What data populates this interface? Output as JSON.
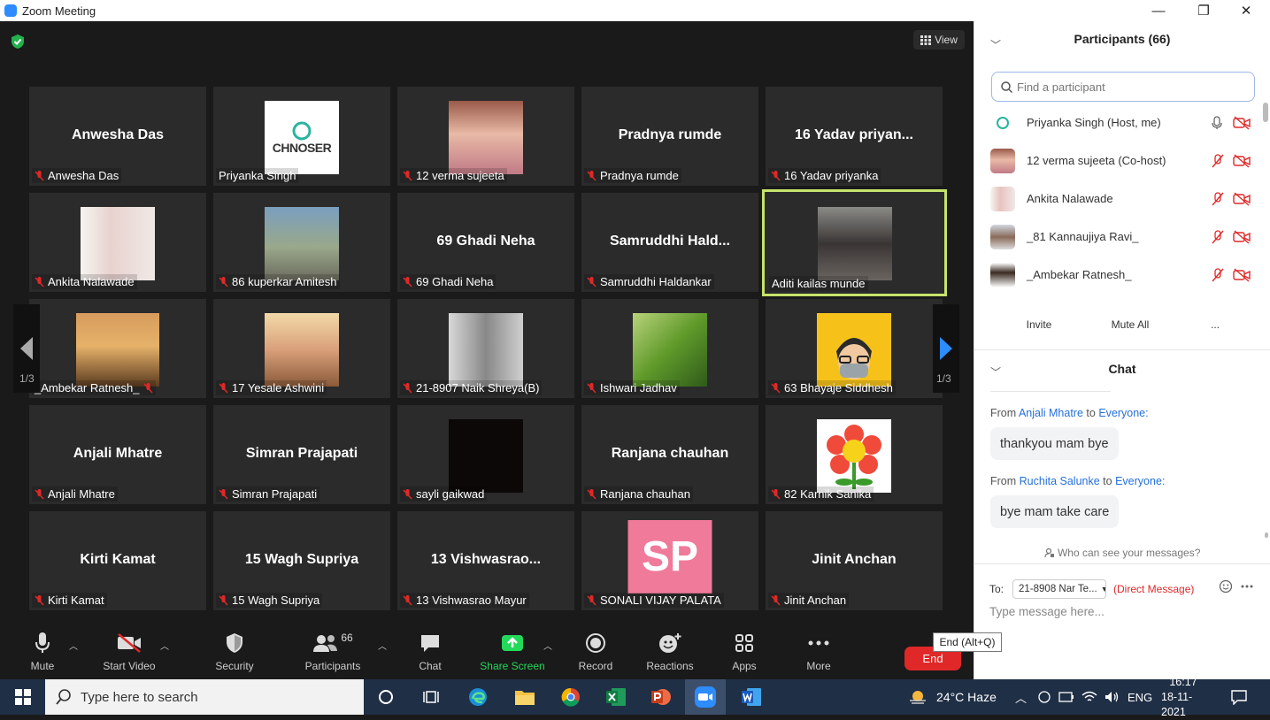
{
  "window": {
    "title": "Zoom Meeting",
    "min": "—",
    "max": "❐",
    "close": "✕"
  },
  "view": {
    "label": "View"
  },
  "pages": {
    "left": "1/3",
    "right": "1/3"
  },
  "tiles": [
    {
      "name": "Anwesha Das",
      "big": "Anwesha Das",
      "muted": true
    },
    {
      "name": "Priyanka Singh",
      "big": "",
      "muted": false,
      "logo": "CHNOSER"
    },
    {
      "name": "12 verma sujeeta",
      "big": "",
      "muted": true
    },
    {
      "name": "Pradnya rumde",
      "big": "Pradnya rumde",
      "muted": true
    },
    {
      "name": "16  Yadav priyanka",
      "big": "16  Yadav priyan...",
      "muted": true
    },
    {
      "name": "Ankita Nalawade",
      "big": "",
      "muted": true
    },
    {
      "name": "86 kuperkar Amitesh",
      "big": "",
      "muted": true
    },
    {
      "name": "69 Ghadi Neha",
      "big": "69 Ghadi Neha",
      "muted": true
    },
    {
      "name": "Samruddhi Haldankar",
      "big": "Samruddhi  Hald...",
      "muted": true
    },
    {
      "name": "Aditi kailas munde",
      "big": "",
      "muted": false
    },
    {
      "name": "_Ambekar Ratnesh_",
      "big": "",
      "muted": true
    },
    {
      "name": "17 Yesale Ashwini",
      "big": "",
      "muted": true
    },
    {
      "name": "21-8907 Naik Shreya(B)",
      "big": "",
      "muted": true
    },
    {
      "name": "Ishwari Jadhav",
      "big": "",
      "muted": true
    },
    {
      "name": "63 Bhayaje Siddhesh",
      "big": "",
      "muted": true
    },
    {
      "name": "Anjali Mhatre",
      "big": "Anjali Mhatre",
      "muted": true
    },
    {
      "name": "Simran Prajapati",
      "big": "Simran Prajapati",
      "muted": true
    },
    {
      "name": "sayli gaikwad",
      "big": "",
      "muted": true
    },
    {
      "name": "Ranjana chauhan",
      "big": "Ranjana chauhan",
      "muted": true
    },
    {
      "name": "82 Karnik Sanika",
      "big": "",
      "muted": true
    },
    {
      "name": "Kirti Kamat",
      "big": "Kirti Kamat",
      "muted": true
    },
    {
      "name": "15 Wagh Supriya",
      "big": "15 Wagh Supriya",
      "muted": true
    },
    {
      "name": "13 Vishwasrao Mayur",
      "big": "13  Vishwasrao...",
      "muted": true
    },
    {
      "name": "SONALI VIJAY PALATA",
      "big": "",
      "muted": true,
      "initials": "SP"
    },
    {
      "name": "Jinit Anchan",
      "big": "Jinit Anchan",
      "muted": true
    }
  ],
  "toolbar": {
    "mute": "Mute",
    "start_video": "Start Video",
    "security": "Security",
    "participants": "Participants",
    "participants_count": "66",
    "chat": "Chat",
    "share_screen": "Share Screen",
    "record": "Record",
    "reactions": "Reactions",
    "apps": "Apps",
    "more": "More",
    "end": "End",
    "end_tooltip": "End (Alt+Q)"
  },
  "participants_panel": {
    "title": "Participants (66)",
    "search_placeholder": "Find a participant",
    "list": [
      {
        "name": "Priyanka Singh (Host, me)"
      },
      {
        "name": "12 verma sujeeta (Co-host)"
      },
      {
        "name": "Ankita Nalawade"
      },
      {
        "name": "_81 Kannaujiya Ravi_"
      },
      {
        "name": "_Ambekar Ratnesh_"
      }
    ],
    "invite": "Invite",
    "mute_all": "Mute All",
    "more": "..."
  },
  "chat_panel": {
    "title": "Chat",
    "messages": [
      {
        "from_prefix": "From",
        "sender": "Anjali Mhatre",
        "to_word": "to",
        "recipient": "Everyone:",
        "text": "thankyou mam bye"
      },
      {
        "from_prefix": "From",
        "sender": "Ruchita Salunke",
        "to_word": "to",
        "recipient": "Everyone:",
        "text": "bye mam take care"
      }
    ],
    "who_can_see": "Who can see your messages?",
    "to_label": "To:",
    "to_value": "21-8908 Nar Te...",
    "direct": "(Direct Message)",
    "placeholder": "Type message here..."
  },
  "taskbar": {
    "search_placeholder": "Type here to search",
    "weather": "24°C  Haze",
    "lang": "ENG",
    "time": "16:17",
    "date": "18-11-2021"
  },
  "colors": {
    "accent": "#2d8cff",
    "end": "#e02828",
    "active_border": "#c6e36a",
    "share": "#23d959"
  }
}
